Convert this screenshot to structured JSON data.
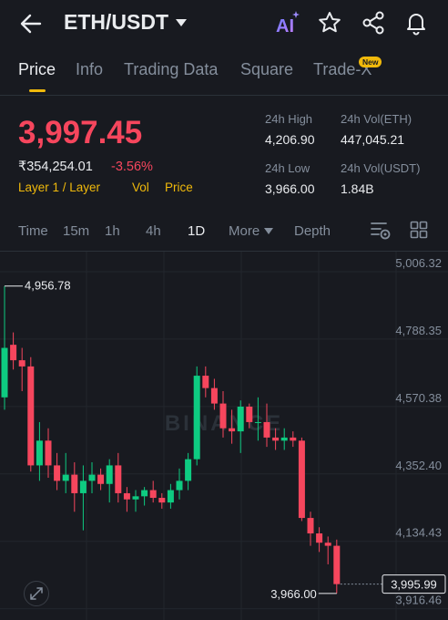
{
  "header": {
    "pair": "ETH/USDT",
    "icons": [
      "back-arrow-icon",
      "chevron-down-icon",
      "ai-icon",
      "star-icon",
      "share-icon",
      "bell-icon"
    ],
    "ai_label": "AI"
  },
  "tabs": [
    {
      "label": "Price",
      "active": true
    },
    {
      "label": "Info"
    },
    {
      "label": "Trading Data"
    },
    {
      "label": "Square"
    },
    {
      "label": "Trade-X",
      "badge": "New"
    }
  ],
  "price": {
    "last": "3,997.45",
    "inr": "₹354,254.01",
    "change": "-3.56%",
    "tags": [
      "Layer 1 / Layer",
      "Vol",
      "Price"
    ]
  },
  "stats": {
    "high_label": "24h High",
    "high": "4,206.90",
    "low_label": "24h Low",
    "low": "3,966.00",
    "vol_eth_label": "24h Vol(ETH)",
    "vol_eth": "447,045.21",
    "vol_usdt_label": "24h Vol(USDT)",
    "vol_usdt": "1.84B"
  },
  "intervals": {
    "items": [
      "Time",
      "15m",
      "1h",
      "4h",
      "1D",
      "More",
      "Depth"
    ],
    "active": "1D"
  },
  "chart_data": {
    "type": "candlestick",
    "watermark": "BINANCE",
    "y_ticks": [
      "5,006.32",
      "4,788.35",
      "4,570.38",
      "4,352.40",
      "4,134.43",
      "3,916.46"
    ],
    "ylim": [
      3880,
      5006.32
    ],
    "high_marker": "4,956.78",
    "low_marker": "3,966.00",
    "last_price_marker": "3,995.99",
    "up_color": "#0ecb81",
    "down_color": "#f6465d",
    "candles": [
      {
        "o": 4600,
        "h": 4960,
        "l": 4560,
        "c": 4760
      },
      {
        "o": 4770,
        "h": 4810,
        "l": 4690,
        "c": 4720
      },
      {
        "o": 4720,
        "h": 4760,
        "l": 4620,
        "c": 4700
      },
      {
        "o": 4700,
        "h": 4730,
        "l": 4360,
        "c": 4380
      },
      {
        "o": 4380,
        "h": 4520,
        "l": 4330,
        "c": 4460
      },
      {
        "o": 4460,
        "h": 4500,
        "l": 4340,
        "c": 4380
      },
      {
        "o": 4380,
        "h": 4420,
        "l": 4300,
        "c": 4330
      },
      {
        "o": 4330,
        "h": 4420,
        "l": 4290,
        "c": 4350
      },
      {
        "o": 4350,
        "h": 4390,
        "l": 4230,
        "c": 4290
      },
      {
        "o": 4290,
        "h": 4380,
        "l": 4170,
        "c": 4330
      },
      {
        "o": 4330,
        "h": 4390,
        "l": 4290,
        "c": 4350
      },
      {
        "o": 4350,
        "h": 4370,
        "l": 4300,
        "c": 4320
      },
      {
        "o": 4320,
        "h": 4400,
        "l": 4260,
        "c": 4380
      },
      {
        "o": 4380,
        "h": 4420,
        "l": 4260,
        "c": 4290
      },
      {
        "o": 4290,
        "h": 4310,
        "l": 4230,
        "c": 4270
      },
      {
        "o": 4270,
        "h": 4300,
        "l": 4230,
        "c": 4280
      },
      {
        "o": 4280,
        "h": 4310,
        "l": 4250,
        "c": 4300
      },
      {
        "o": 4300,
        "h": 4330,
        "l": 4260,
        "c": 4275
      },
      {
        "o": 4275,
        "h": 4290,
        "l": 4240,
        "c": 4260
      },
      {
        "o": 4260,
        "h": 4320,
        "l": 4240,
        "c": 4300
      },
      {
        "o": 4300,
        "h": 4370,
        "l": 4270,
        "c": 4330
      },
      {
        "o": 4330,
        "h": 4420,
        "l": 4300,
        "c": 4400
      },
      {
        "o": 4400,
        "h": 4700,
        "l": 4380,
        "c": 4670
      },
      {
        "o": 4670,
        "h": 4700,
        "l": 4600,
        "c": 4630
      },
      {
        "o": 4630,
        "h": 4660,
        "l": 4560,
        "c": 4580
      },
      {
        "o": 4580,
        "h": 4620,
        "l": 4470,
        "c": 4500
      },
      {
        "o": 4500,
        "h": 4560,
        "l": 4450,
        "c": 4490
      },
      {
        "o": 4490,
        "h": 4590,
        "l": 4420,
        "c": 4570
      },
      {
        "o": 4570,
        "h": 4580,
        "l": 4500,
        "c": 4520
      },
      {
        "o": 4520,
        "h": 4600,
        "l": 4460,
        "c": 4520
      },
      {
        "o": 4520,
        "h": 4580,
        "l": 4440,
        "c": 4470
      },
      {
        "o": 4470,
        "h": 4500,
        "l": 4430,
        "c": 4460
      },
      {
        "o": 4460,
        "h": 4500,
        "l": 4430,
        "c": 4470
      },
      {
        "o": 4470,
        "h": 4490,
        "l": 4440,
        "c": 4460
      },
      {
        "o": 4460,
        "h": 4470,
        "l": 4200,
        "c": 4210
      },
      {
        "o": 4210,
        "h": 4230,
        "l": 4120,
        "c": 4160
      },
      {
        "o": 4160,
        "h": 4180,
        "l": 4100,
        "c": 4130
      },
      {
        "o": 4130,
        "h": 4150,
        "l": 4060,
        "c": 4120
      },
      {
        "o": 4120,
        "h": 4140,
        "l": 3966,
        "c": 3996
      }
    ]
  }
}
